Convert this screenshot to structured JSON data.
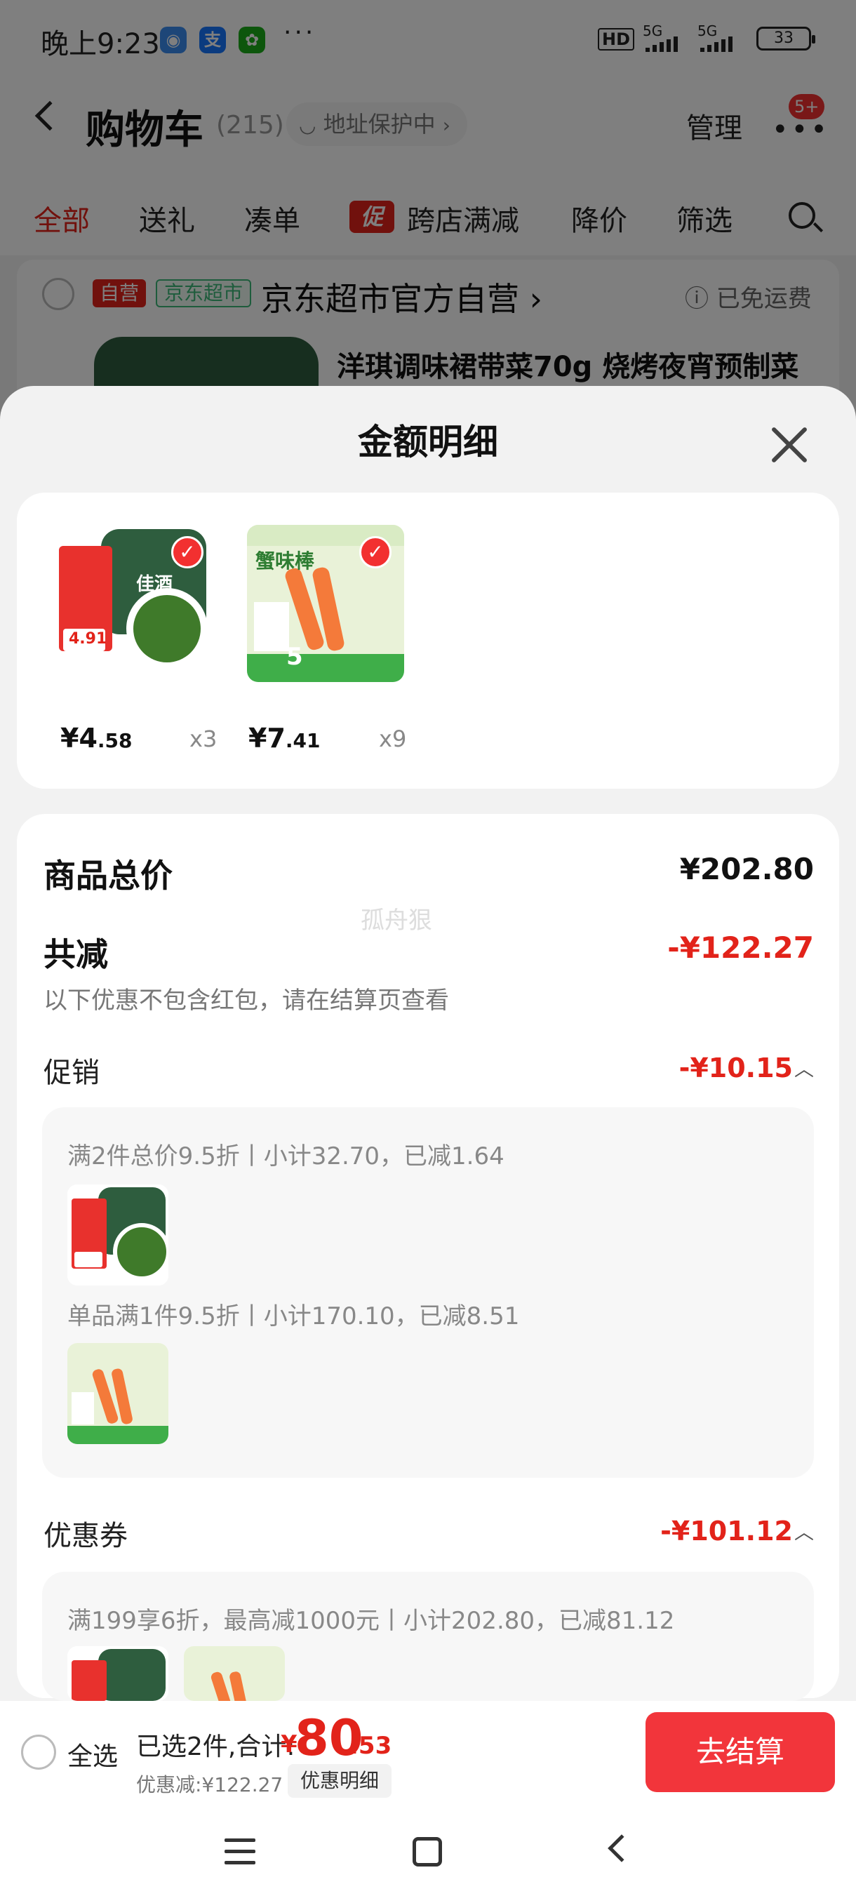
{
  "status_bar": {
    "time": "晚上9:23",
    "app1": "◉",
    "app2": "支",
    "app3": "✿",
    "more": "···",
    "hd": "HD",
    "net1": "5G",
    "net2": "5G",
    "battery": "33"
  },
  "header": {
    "title": "购物车",
    "count": "(215)",
    "address": "地址保护中",
    "manage": "管理",
    "more": "•••",
    "badge": "5+"
  },
  "tabs": [
    "全部",
    "送礼",
    "凑单",
    "跨店满减",
    "降价",
    "筛选"
  ],
  "tab_promo_icon": "促",
  "store": {
    "tag_self": "自营",
    "tag_market": "京东超市",
    "name": "京东超市官方自营 ›",
    "shipping": "ⓘ 已免运费",
    "product_title": "洋琪调味裙带菜70g 烧烤夜宵预制菜"
  },
  "sheet": {
    "title": "金额明细",
    "items": [
      {
        "yen": "¥",
        "price_int": "4",
        "price_dec": ".58",
        "qty": "x3",
        "img_text": "佳酒",
        "img_tag": "4.91"
      },
      {
        "yen": "¥",
        "price_int": "7",
        "price_dec": ".41",
        "qty": "x9",
        "img_text": "蟹味棒",
        "img_tag": "5"
      }
    ],
    "total_label": "商品总价",
    "total_value": "¥202.80",
    "discount_label": "共减",
    "discount_value": "-¥122.27",
    "discount_note": "以下优惠不包含红包，请在结算页查看",
    "watermark": "孤舟狠",
    "promo_label": "促销",
    "promo_value": "-¥10.15",
    "promo_rows": [
      "满2件总价9.5折丨小计32.70，已减1.64",
      "单品满1件9.5折丨小计170.10，已减8.51"
    ],
    "coupon_label": "优惠券",
    "coupon_value": "-¥101.12",
    "coupon_row": "满199享6折，最高减1000元丨小计202.80，已减81.12"
  },
  "bottom": {
    "select_all": "全选",
    "selected": "已选2件,合计:",
    "yen": "¥",
    "total_int": "80",
    "total_dec": ".53",
    "discount": "优惠减:¥122.27",
    "detail_btn": "优惠明细",
    "checkout": "去结算"
  },
  "colors": {
    "accent": "#e2231a",
    "checkout": "#f2353b",
    "green": "#3cb878"
  }
}
